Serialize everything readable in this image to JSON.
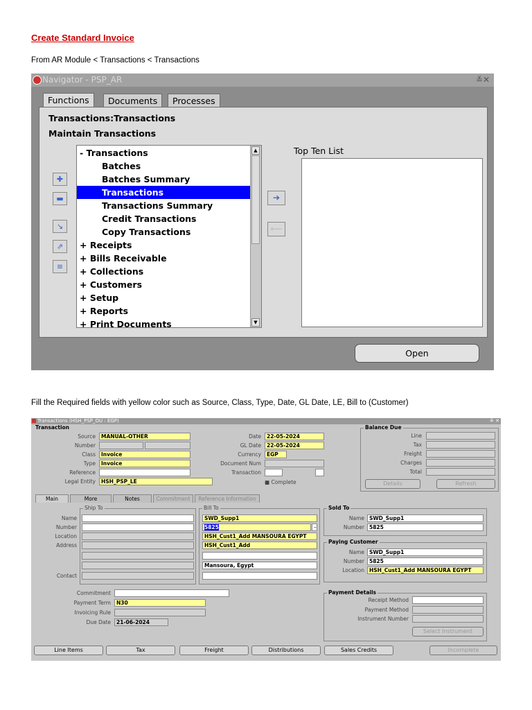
{
  "doc": {
    "title": "Create Standard Invoice",
    "path": "From AR Module < Transactions < Transactions",
    "instruction": "Fill the Required fields with yellow color such as Source, Class, Type, Date, GL Date, LE, Bill to (Customer)"
  },
  "navigator": {
    "title": "Navigator - PSP_AR",
    "controls": "≚✕",
    "tabs": [
      "Functions",
      "Documents",
      "Processes"
    ],
    "heading1": "Transactions:Transactions",
    "heading2": "Maintain Transactions",
    "list": [
      "- Transactions",
      "Batches",
      "Batches Summary",
      "Transactions",
      "Transactions Summary",
      "Credit Transactions",
      "Copy Transactions",
      "+ Receipts",
      "+ Bills Receivable",
      "+ Collections",
      "+ Customers",
      "+ Setup",
      "+ Reports",
      "+ Print Documents"
    ],
    "selected_index": 3,
    "top_ten_label": "Top Ten List",
    "open_button": "Open",
    "side_icons": [
      "add-icon",
      "remove-icon",
      "expand-branch-icon",
      "expand-all-icon",
      "collapse-all-icon"
    ]
  },
  "form": {
    "title": "Transactions (HSH_PSP_OU : EGP)",
    "controls": "≚ ✕",
    "transaction_group": "Transaction",
    "labels": {
      "source": "Source",
      "number": "Number",
      "class": "Class",
      "type": "Type",
      "reference": "Reference",
      "legal_entity": "Legal Entity",
      "date": "Date",
      "gl_date": "GL Date",
      "currency": "Currency",
      "document_num": "Document Num",
      "transaction": "Transaction",
      "complete": "Complete"
    },
    "values": {
      "source": "MANUAL-OTHER",
      "class": "Invoice",
      "type": "Invoice",
      "legal_entity": "HSH_PSP_LE",
      "date": "22-05-2024",
      "gl_date": "22-05-2024",
      "currency": "EGP"
    },
    "balance": {
      "title": "Balance Due",
      "labels": [
        "Line",
        "Tax",
        "Freight",
        "Charges",
        "Total"
      ],
      "details_button": "Details",
      "refresh_button": "Refresh"
    },
    "tabs": [
      "Main",
      "More",
      "Notes",
      "Commitment",
      "Reference Information"
    ],
    "ship_to": {
      "title": "Ship To",
      "labels": [
        "Name",
        "Number",
        "Location",
        "Address",
        "Contact"
      ]
    },
    "bill_to": {
      "title": "Bill To",
      "name": "SWD_Supp1",
      "number": "5825",
      "location": "HSH_Cust1_Add MANSOURA EGYPT",
      "address1": "HSH_Cust1_Add",
      "address3": "Mansoura,  Egypt"
    },
    "sold_to": {
      "title": "Sold To",
      "name_label": "Name",
      "number_label": "Number",
      "name": "SWD_Supp1",
      "number": "5825"
    },
    "paying_customer": {
      "title": "Paying Customer",
      "name_label": "Name",
      "number_label": "Number",
      "location_label": "Location",
      "name": "SWD_Supp1",
      "number": "5825",
      "location": "HSH_Cust1_Add MANSOURA EGYPT"
    },
    "terms": {
      "labels": [
        "Commitment",
        "Payment Term",
        "Invoicing Rule",
        "Due Date"
      ],
      "payment_term": "N30",
      "due_date": "21-06-2024"
    },
    "payment_details": {
      "title": "Payment Details",
      "labels": [
        "Receipt Method",
        "Payment Method",
        "Instrument Number"
      ],
      "select_button": "Select Instrument"
    },
    "bottom_buttons": [
      "Line Items",
      "Tax",
      "Freight",
      "Distributions",
      "Sales Credits",
      "Incomplete"
    ]
  }
}
